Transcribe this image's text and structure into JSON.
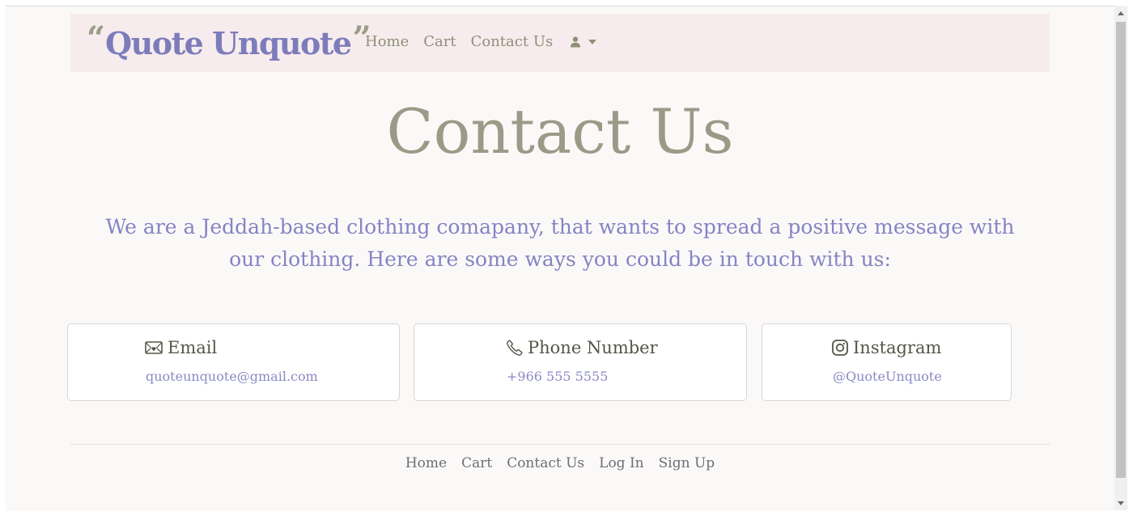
{
  "navbar": {
    "brand": {
      "open_quote": "“",
      "name": "Quote Unquote",
      "close_quote": "”"
    },
    "links": [
      "Home",
      "Cart",
      "Contact Us"
    ],
    "user_icon": "person-icon",
    "dropdown_icon": "caret-down-icon"
  },
  "hero": {
    "title": "Contact Us"
  },
  "intro": {
    "text": "We are a Jeddah-based clothing comapany, that wants to spread a positive message with our clothing. Here are some ways you could be in touch with us:"
  },
  "cards": [
    {
      "icon": "envelope-heart-icon",
      "title": "Email",
      "value": "quoteunquote@gmail.com"
    },
    {
      "icon": "phone-icon",
      "title": "Phone Number",
      "value": "+966 555 5555"
    },
    {
      "icon": "instagram-icon",
      "title": "Instagram",
      "value": "@QuoteUnquote"
    }
  ],
  "footer": {
    "links": [
      "Home",
      "Cart",
      "Contact Us",
      "Log In",
      "Sign Up"
    ]
  },
  "colors": {
    "accent_purple": "#7d7cbb",
    "accent_olive": "#9a9b87",
    "navbar_bg": "#f7eced",
    "page_bg": "#fbf9f8"
  }
}
